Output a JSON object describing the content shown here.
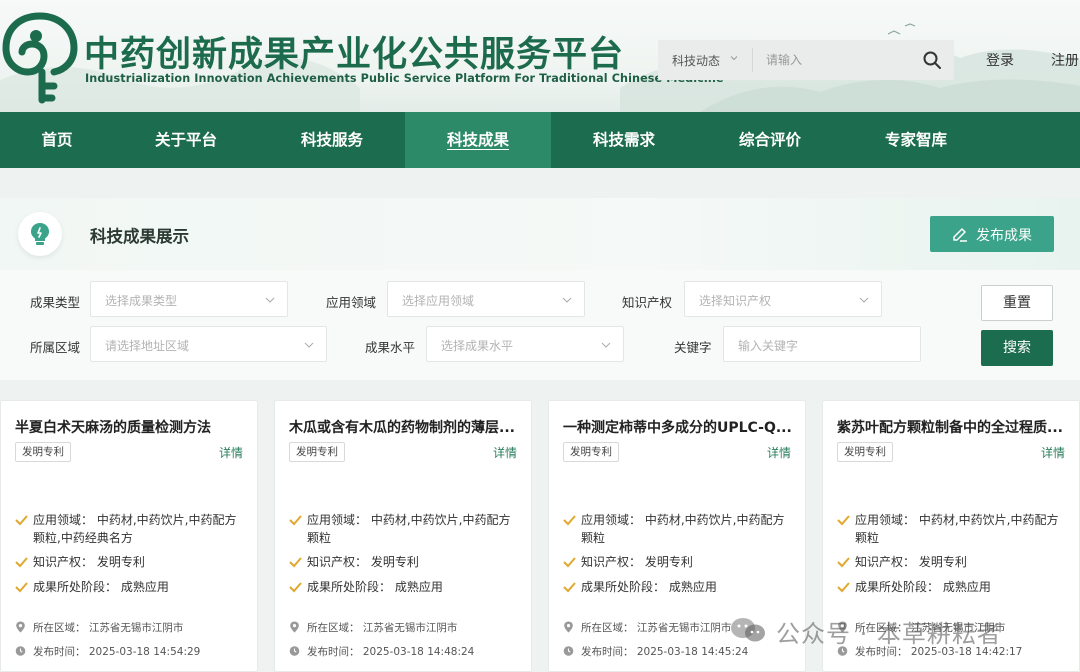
{
  "header": {
    "title": "中药创新成果产业化公共服务平台",
    "subtitle": "Industrialization Innovation Achievements Public Service Platform For Traditional Chinese Medicine",
    "search": {
      "category": "科技动态",
      "placeholder": "请输入"
    },
    "login": "登录",
    "register": "注册"
  },
  "nav": {
    "items": [
      "首页",
      "关于平台",
      "科技服务",
      "科技成果",
      "科技需求",
      "综合评价",
      "专家智库"
    ],
    "active_index": 3
  },
  "section": {
    "title": "科技成果展示",
    "publish_button": "发布成果"
  },
  "filters": {
    "type_label": "成果类型",
    "type_placeholder": "选择成果类型",
    "field_label": "应用领域",
    "field_placeholder": "选择应用领域",
    "ip_label": "知识产权",
    "ip_placeholder": "选择知识产权",
    "region_label": "所属区域",
    "region_placeholder": "请选择地址区域",
    "level_label": "成果水平",
    "level_placeholder": "选择成果水平",
    "keyword_label": "关键字",
    "keyword_placeholder": "输入关键字",
    "reset_button": "重置",
    "search_button": "搜索"
  },
  "cards": [
    {
      "title": "半夏白术天麻汤的质量检测方法",
      "tag": "发明专利",
      "detail": "详情",
      "field": "应用领域：  中药材,中药饮片,中药配方颗粒,中药经典名方",
      "ip": "知识产权：  发明专利",
      "stage": "成果所处阶段：  成熟应用",
      "region": "所在区域：   江苏省无锡市江阴市",
      "time": "发布时间：   2025-03-18 14:54:29"
    },
    {
      "title": "木瓜或含有木瓜的药物制剂的薄层...",
      "tag": "发明专利",
      "detail": "详情",
      "field": "应用领域：  中药材,中药饮片,中药配方颗粒",
      "ip": "知识产权：  发明专利",
      "stage": "成果所处阶段：  成熟应用",
      "region": "所在区域：   江苏省无锡市江阴市",
      "time": "发布时间：   2025-03-18 14:48:24"
    },
    {
      "title": "一种测定柿蒂中多成分的UPLC-Q...",
      "tag": "发明专利",
      "detail": "详情",
      "field": "应用领域：  中药材,中药饮片,中药配方颗粒",
      "ip": "知识产权：  发明专利",
      "stage": "成果所处阶段：  成熟应用",
      "region": "所在区域：   江苏省无锡市江阴市",
      "time": "发布时间：   2025-03-18 14:45:24"
    },
    {
      "title": "紫苏叶配方颗粒制备中的全过程质...",
      "tag": "发明专利",
      "detail": "详情",
      "field": "应用领域：  中药材,中药饮片,中药配方颗粒",
      "ip": "知识产权：  发明专利",
      "stage": "成果所处阶段：  成熟应用",
      "region": "所在区域：   江苏省无锡市江阴市",
      "time": "发布时间：   2025-03-18 14:42:17"
    }
  ],
  "watermark": "公众号 · 本草耕耘者",
  "colors": {
    "brand_green": "#1c6c4f",
    "active_nav": "#2d8a69",
    "accent_teal": "#3aa38a",
    "check_gold": "#e0a82e"
  }
}
